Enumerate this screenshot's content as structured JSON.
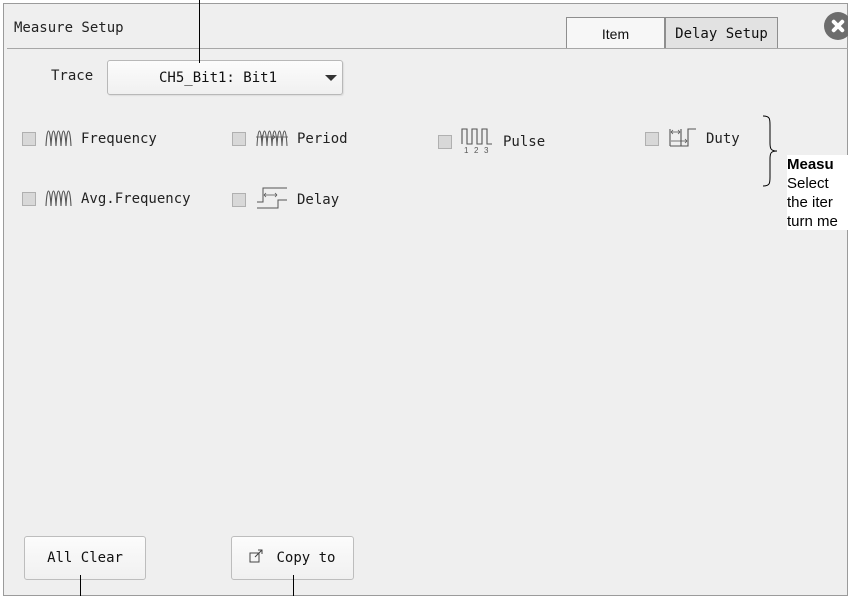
{
  "window": {
    "title": "Measure Setup"
  },
  "tabs": [
    {
      "label": "Item"
    },
    {
      "label": "Delay Setup"
    }
  ],
  "trace": {
    "label": "Trace",
    "value": "CH5_Bit1: Bit1"
  },
  "items": [
    {
      "label": "Frequency",
      "icon": "frequency-wave-icon",
      "checked": false
    },
    {
      "label": "Period",
      "icon": "period-wave-icon",
      "checked": false
    },
    {
      "label": "Pulse",
      "icon": "pulse-train-icon",
      "checked": false
    },
    {
      "label": "Duty",
      "icon": "duty-cycle-icon",
      "checked": false
    },
    {
      "label": "Avg.Frequency",
      "icon": "avg-frequency-icon",
      "checked": false
    },
    {
      "label": "Delay",
      "icon": "delay-icon",
      "checked": false
    }
  ],
  "annotation": {
    "title": "Measu",
    "lines": [
      "Select",
      "the iter",
      "turn me"
    ]
  },
  "buttons": {
    "all_clear": "All Clear",
    "copy_to": "Copy to"
  }
}
